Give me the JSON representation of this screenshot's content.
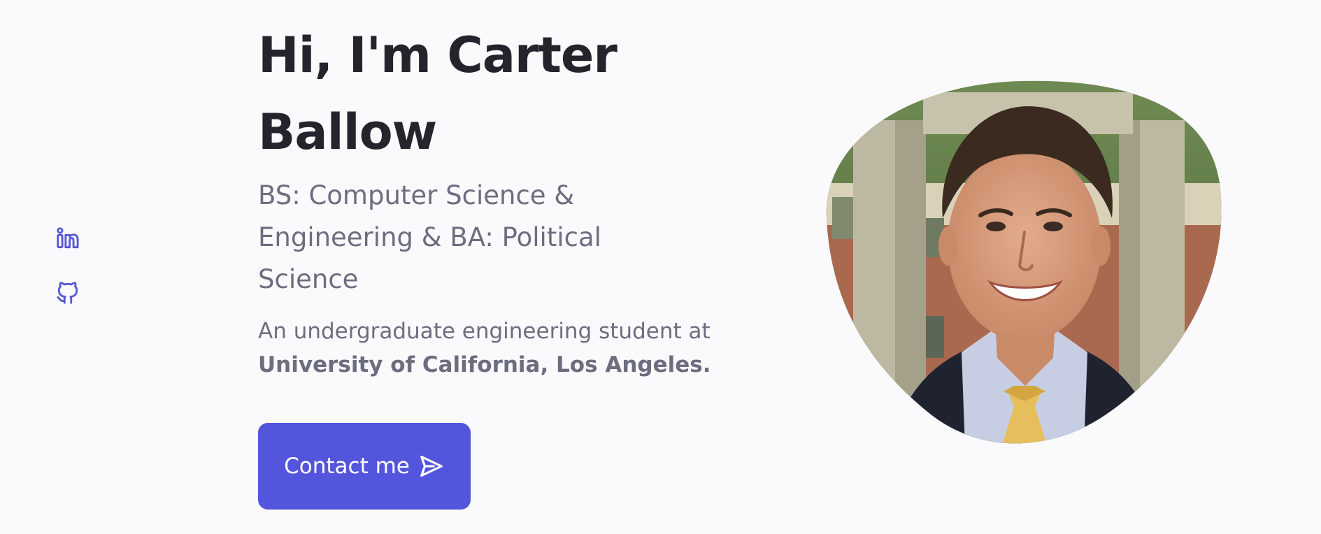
{
  "social": {
    "linkedin_icon": "linkedin-icon",
    "github_icon": "github-icon"
  },
  "hero": {
    "title": "Hi, I'm Carter Ballow",
    "subtitle": "BS: Computer Science & Engineering & BA: Political Science",
    "description": "An undergraduate engineering student at",
    "description_bold": "University of California, Los Angeles.",
    "contact_label": "Contact me",
    "contact_icon": "send-icon"
  },
  "profile": {
    "image_alt": "Carter Ballow portrait"
  },
  "colors": {
    "accent": "#5355dd",
    "heading": "#24242d",
    "text": "#6d6d80",
    "background": "#fafafc"
  }
}
